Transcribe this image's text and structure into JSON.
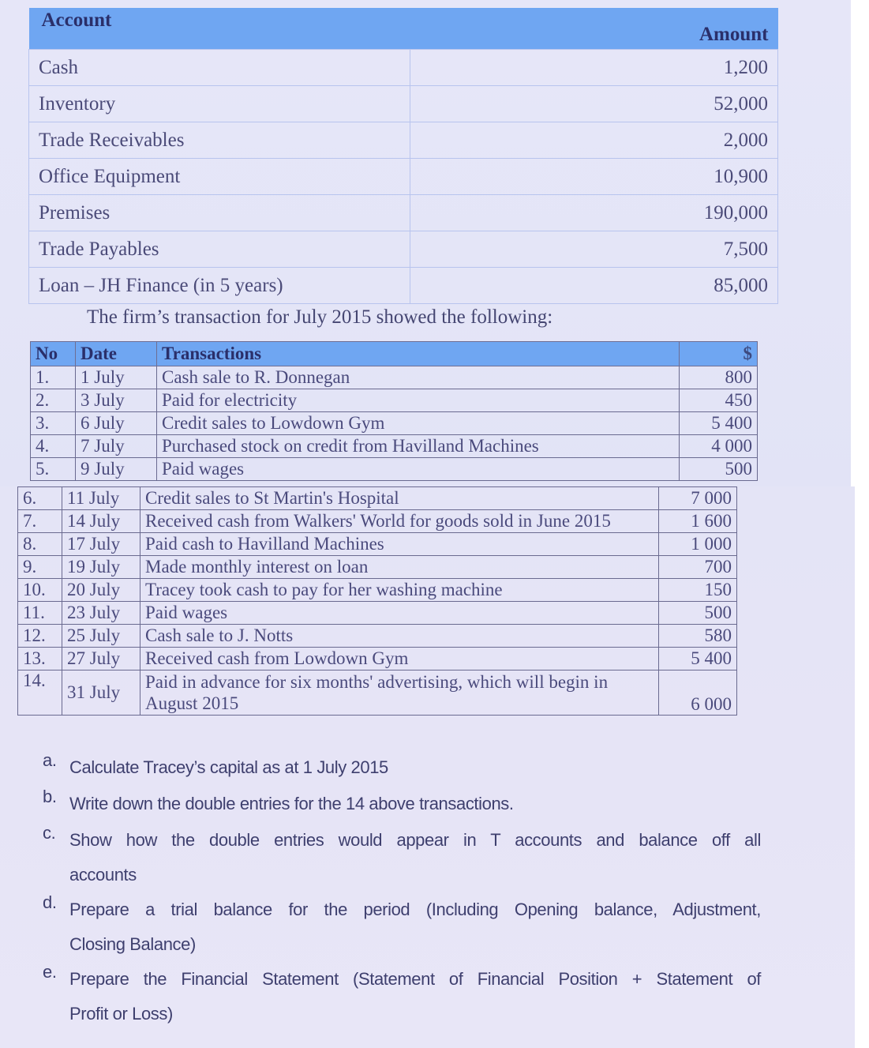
{
  "opening_balances": {
    "headers": {
      "account": "Account",
      "amount": "Amount"
    },
    "rows": [
      {
        "account": "Cash",
        "amount": "1,200"
      },
      {
        "account": "Inventory",
        "amount": "52,000"
      },
      {
        "account": "Trade Receivables",
        "amount": "2,000"
      },
      {
        "account": "Office Equipment",
        "amount": "10,900"
      },
      {
        "account": "Premises",
        "amount": "190,000"
      },
      {
        "account": "Trade Payables",
        "amount": "7,500"
      },
      {
        "account": "Loan – JH Finance (in 5 years)",
        "amount": "85,000"
      }
    ]
  },
  "intro_text": "The firm’s transaction for July 2015 showed the following:",
  "transactions": {
    "headers": {
      "no": "No",
      "date": "Date",
      "transaction": "Transactions",
      "amount": "$"
    },
    "rows": [
      {
        "no": "1.",
        "date": "1 July",
        "description": "Cash sale to R. Donnegan",
        "amount": "800"
      },
      {
        "no": "2.",
        "date": "3 July",
        "description": "Paid for electricity",
        "amount": "450"
      },
      {
        "no": "3.",
        "date": "6 July",
        "description": "Credit sales to Lowdown Gym",
        "amount": "5 400"
      },
      {
        "no": "4.",
        "date": "7 July",
        "description": "Purchased stock on credit from Havilland Machines",
        "amount": "4 000"
      },
      {
        "no": "5.",
        "date": "9 July",
        "description": "Paid wages",
        "amount": "500"
      },
      {
        "no": "6.",
        "date": "11 July",
        "description": "Credit sales to St Martin's Hospital",
        "amount": "7 000"
      },
      {
        "no": "7.",
        "date": "14 July",
        "description": "Received cash from Walkers' World for goods sold in June 2015",
        "amount": "1 600"
      },
      {
        "no": "8.",
        "date": "17 July",
        "description": "Paid cash to Havilland Machines",
        "amount": "1 000"
      },
      {
        "no": "9.",
        "date": "19 July",
        "description": "Made monthly interest on loan",
        "amount": "700"
      },
      {
        "no": "10.",
        "date": "20 July",
        "description": "Tracey took cash to pay for her washing machine",
        "amount": "150"
      },
      {
        "no": "11.",
        "date": "23 July",
        "description": "Paid wages",
        "amount": "500"
      },
      {
        "no": "12.",
        "date": "25 July",
        "description": "Cash sale to J. Notts",
        "amount": "580"
      },
      {
        "no": "13.",
        "date": "27 July",
        "description": "Received cash from Lowdown Gym",
        "amount": "5 400"
      },
      {
        "no": "14.",
        "date": "31 July",
        "description_line1": "Paid in advance for six months' advertising, which will begin in",
        "description_line2": "August 2015",
        "amount": "6 000"
      }
    ]
  },
  "questions": [
    {
      "letter": "a.",
      "text": "Calculate Tracey’s capital as at 1 July 2015"
    },
    {
      "letter": "b.",
      "text": "Write down the double entries for the 14 above transactions."
    },
    {
      "letter": "c.",
      "line1": "Show how the double entries would appear in T accounts and balance off all",
      "line2": "accounts"
    },
    {
      "letter": "d.",
      "line1": "Prepare a trial balance for the period (Including Opening balance, Adjustment,",
      "line2": "Closing Balance)"
    },
    {
      "letter": "e.",
      "line1": "Prepare the Financial Statement (Statement of Financial Position + Statement of",
      "line2": "Profit or Loss)"
    }
  ]
}
